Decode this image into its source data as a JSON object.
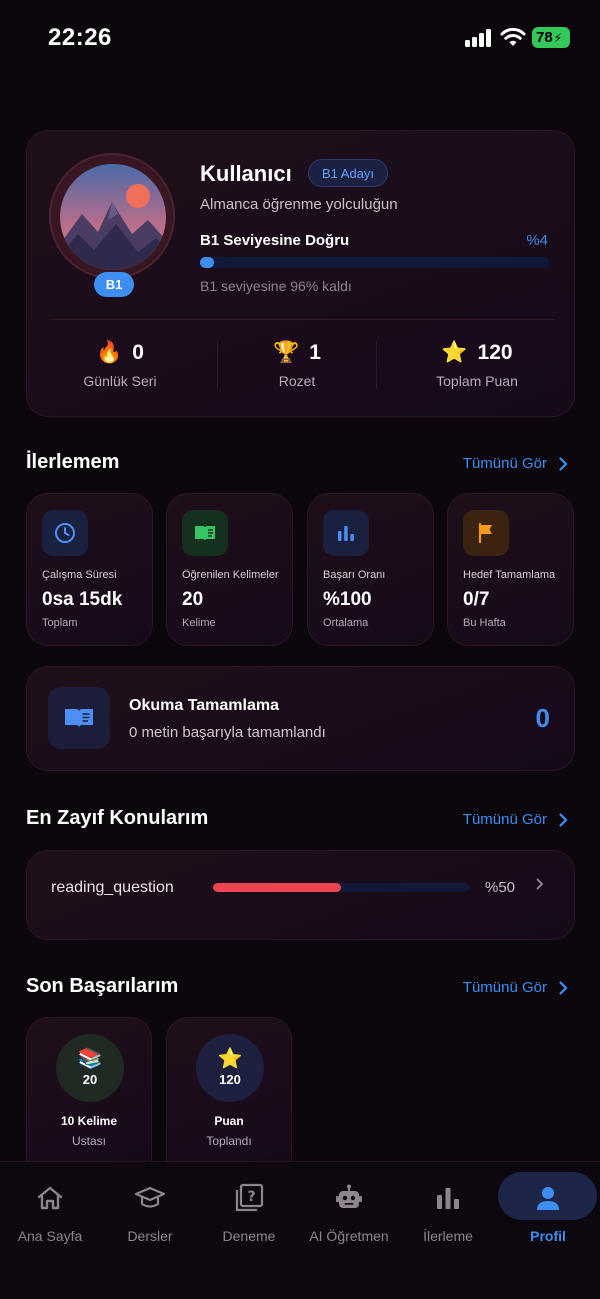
{
  "status_bar": {
    "time": "22:26",
    "battery": "78"
  },
  "profile": {
    "name": "Kullanıcı",
    "badge": "B1 Adayı",
    "subtitle": "Almanca öğrenme yolculuğun",
    "level": "B1",
    "progress_label": "B1 Seviyesine Doğru",
    "progress_percent_text": "%4",
    "progress_value": 4,
    "progress_note": "B1 seviyesine 96% kaldı",
    "stats": [
      {
        "icon": "fire-icon",
        "value": "0",
        "label": "Günlük Seri"
      },
      {
        "icon": "trophy-icon",
        "value": "1",
        "label": "Rozet"
      },
      {
        "icon": "star-icon",
        "value": "120",
        "label": "Toplam Puan"
      }
    ]
  },
  "progress_section": {
    "title": "İlerlemem",
    "see_all": "Tümünü Gör",
    "cards": [
      {
        "icon": "clock-icon",
        "title": "Çalışma Süresi",
        "value": "0sa 15dk",
        "sub": "Toplam"
      },
      {
        "icon": "book-icon",
        "title": "Öğrenilen Kelimeler",
        "value": "20",
        "sub": "Kelime"
      },
      {
        "icon": "bar-chart-icon",
        "title": "Başarı Oranı",
        "value": "%100",
        "sub": "Ortalama"
      },
      {
        "icon": "flag-icon",
        "title": "Hedef Tamamlama",
        "value": "0/7",
        "sub": "Bu Hafta"
      }
    ],
    "reading": {
      "title": "Okuma Tamamlama",
      "subtitle": "0 metin başarıyla tamamlandı",
      "value": "0"
    }
  },
  "weak_section": {
    "title": "En Zayıf Konularım",
    "see_all": "Tümünü Gör",
    "items": [
      {
        "name": "reading_question",
        "percent_text": "%50",
        "value": 50
      }
    ]
  },
  "achievements_section": {
    "title": "Son Başarılarım",
    "see_all": "Tümünü Gör",
    "items": [
      {
        "icon": "books-icon",
        "number": "20",
        "line1": "10 Kelime",
        "line2": "Ustası"
      },
      {
        "icon": "star-icon",
        "number": "120",
        "line1": "Puan",
        "line2": "Toplandı"
      }
    ]
  },
  "bottom_nav": {
    "items": [
      {
        "icon": "home-icon",
        "label": "Ana Sayfa"
      },
      {
        "icon": "graduation-cap-icon",
        "label": "Dersler"
      },
      {
        "icon": "quiz-icon",
        "label": "Deneme"
      },
      {
        "icon": "robot-icon",
        "label": "AI Öğretmen"
      },
      {
        "icon": "bar-chart-icon",
        "label": "İlerleme"
      },
      {
        "icon": "person-icon",
        "label": "Profil"
      }
    ],
    "active": "Profil"
  },
  "colors": {
    "accent": "#3d8ef0",
    "danger": "#f04452",
    "background": "#0c070d",
    "battery": "#34c759"
  }
}
